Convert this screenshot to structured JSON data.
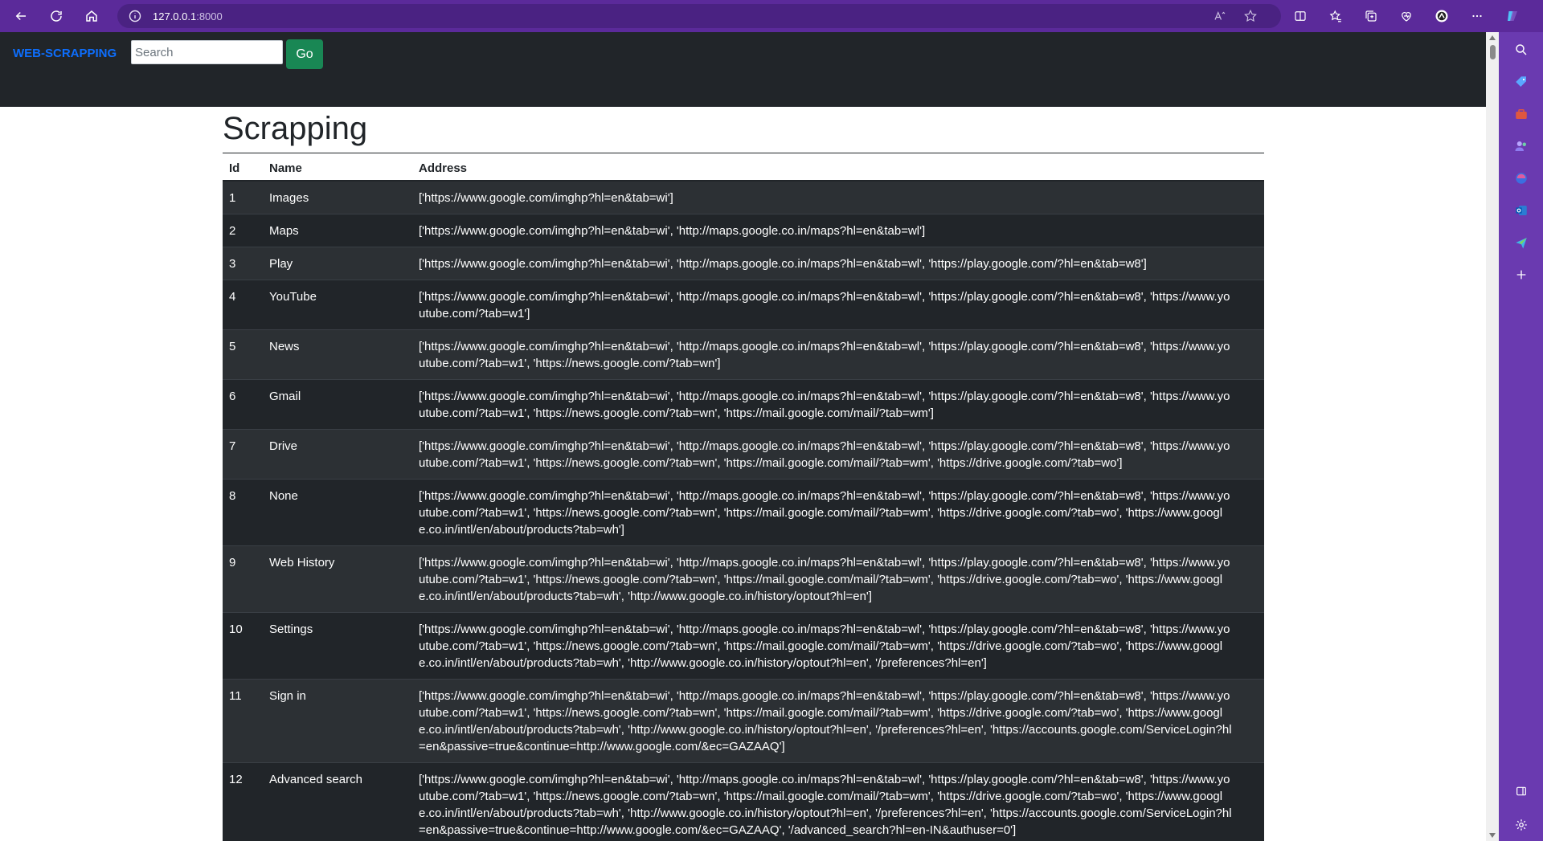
{
  "browser": {
    "url_host": "127.0.0.1",
    "url_port": ":8000"
  },
  "navbar": {
    "brand": "WEB-SCRAPPING",
    "search_placeholder": "Search",
    "go_label": "Go"
  },
  "page": {
    "title": "Scrapping"
  },
  "table": {
    "headers": [
      "Id",
      "Name",
      "Address"
    ],
    "rows": [
      {
        "id": "1",
        "name": "Images",
        "address": "['https://www.google.com/imghp?hl=en&tab=wi']"
      },
      {
        "id": "2",
        "name": "Maps",
        "address": "['https://www.google.com/imghp?hl=en&tab=wi', 'http://maps.google.co.in/maps?hl=en&tab=wl']"
      },
      {
        "id": "3",
        "name": "Play",
        "address": "['https://www.google.com/imghp?hl=en&tab=wi', 'http://maps.google.co.in/maps?hl=en&tab=wl', 'https://play.google.com/?hl=en&tab=w8']"
      },
      {
        "id": "4",
        "name": "YouTube",
        "address": "['https://www.google.com/imghp?hl=en&tab=wi', 'http://maps.google.co.in/maps?hl=en&tab=wl', 'https://play.google.com/?hl=en&tab=w8', 'https://www.youtube.com/?tab=w1']"
      },
      {
        "id": "5",
        "name": "News",
        "address": "['https://www.google.com/imghp?hl=en&tab=wi', 'http://maps.google.co.in/maps?hl=en&tab=wl', 'https://play.google.com/?hl=en&tab=w8', 'https://www.youtube.com/?tab=w1', 'https://news.google.com/?tab=wn']"
      },
      {
        "id": "6",
        "name": "Gmail",
        "address": "['https://www.google.com/imghp?hl=en&tab=wi', 'http://maps.google.co.in/maps?hl=en&tab=wl', 'https://play.google.com/?hl=en&tab=w8', 'https://www.youtube.com/?tab=w1', 'https://news.google.com/?tab=wn', 'https://mail.google.com/mail/?tab=wm']"
      },
      {
        "id": "7",
        "name": "Drive",
        "address": "['https://www.google.com/imghp?hl=en&tab=wi', 'http://maps.google.co.in/maps?hl=en&tab=wl', 'https://play.google.com/?hl=en&tab=w8', 'https://www.youtube.com/?tab=w1', 'https://news.google.com/?tab=wn', 'https://mail.google.com/mail/?tab=wm', 'https://drive.google.com/?tab=wo']"
      },
      {
        "id": "8",
        "name": "None",
        "address": "['https://www.google.com/imghp?hl=en&tab=wi', 'http://maps.google.co.in/maps?hl=en&tab=wl', 'https://play.google.com/?hl=en&tab=w8', 'https://www.youtube.com/?tab=w1', 'https://news.google.com/?tab=wn', 'https://mail.google.com/mail/?tab=wm', 'https://drive.google.com/?tab=wo', 'https://www.google.co.in/intl/en/about/products?tab=wh']"
      },
      {
        "id": "9",
        "name": "Web History",
        "address": "['https://www.google.com/imghp?hl=en&tab=wi', 'http://maps.google.co.in/maps?hl=en&tab=wl', 'https://play.google.com/?hl=en&tab=w8', 'https://www.youtube.com/?tab=w1', 'https://news.google.com/?tab=wn', 'https://mail.google.com/mail/?tab=wm', 'https://drive.google.com/?tab=wo', 'https://www.google.co.in/intl/en/about/products?tab=wh', 'http://www.google.co.in/history/optout?hl=en']"
      },
      {
        "id": "10",
        "name": "Settings",
        "address": "['https://www.google.com/imghp?hl=en&tab=wi', 'http://maps.google.co.in/maps?hl=en&tab=wl', 'https://play.google.com/?hl=en&tab=w8', 'https://www.youtube.com/?tab=w1', 'https://news.google.com/?tab=wn', 'https://mail.google.com/mail/?tab=wm', 'https://drive.google.com/?tab=wo', 'https://www.google.co.in/intl/en/about/products?tab=wh', 'http://www.google.co.in/history/optout?hl=en', '/preferences?hl=en']"
      },
      {
        "id": "11",
        "name": "Sign in",
        "address": "['https://www.google.com/imghp?hl=en&tab=wi', 'http://maps.google.co.in/maps?hl=en&tab=wl', 'https://play.google.com/?hl=en&tab=w8', 'https://www.youtube.com/?tab=w1', 'https://news.google.com/?tab=wn', 'https://mail.google.com/mail/?tab=wm', 'https://drive.google.com/?tab=wo', 'https://www.google.co.in/intl/en/about/products?tab=wh', 'http://www.google.co.in/history/optout?hl=en', '/preferences?hl=en', 'https://accounts.google.com/ServiceLogin?hl=en&passive=true&continue=http://www.google.com/&ec=GAZAAQ']"
      },
      {
        "id": "12",
        "name": "Advanced search",
        "address": "['https://www.google.com/imghp?hl=en&tab=wi', 'http://maps.google.co.in/maps?hl=en&tab=wl', 'https://play.google.com/?hl=en&tab=w8', 'https://www.youtube.com/?tab=w1', 'https://news.google.com/?tab=wn', 'https://mail.google.com/mail/?tab=wm', 'https://drive.google.com/?tab=wo', 'https://www.google.co.in/intl/en/about/products?tab=wh', 'http://www.google.co.in/history/optout?hl=en', '/preferences?hl=en', 'https://accounts.google.com/ServiceLogin?hl=en&passive=true&continue=http://www.google.com/&ec=GAZAAQ', '/advanced_search?hl=en-IN&authuser=0']"
      }
    ]
  },
  "colors": {
    "chrome_bg": "#5b2a9a",
    "navbar_bg": "#212529",
    "brand": "#0d6efd",
    "go_button": "#198754",
    "row_odd": "#2c3034",
    "row_even": "#212529"
  },
  "icons": {
    "chrome_left": [
      "back-arrow-icon",
      "refresh-icon",
      "home-icon"
    ],
    "address": [
      "info-icon",
      "read-aloud-icon",
      "favorite-star-icon"
    ],
    "chrome_right": [
      "split-screen-icon",
      "favorites-icon",
      "collections-icon",
      "performance-heart-icon",
      "profile-icon",
      "more-menu-icon",
      "copilot-icon"
    ],
    "sidebar": [
      "search-icon",
      "tag-icon",
      "toolbox-icon",
      "people-icon",
      "copilot-sphere-icon",
      "outlook-icon",
      "send-icon",
      "add-icon",
      "sidebar-layout-icon",
      "settings-gear-icon"
    ]
  }
}
